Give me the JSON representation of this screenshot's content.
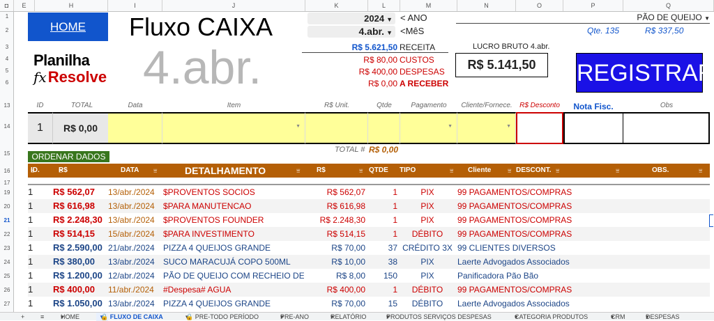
{
  "colhdr": [
    "E",
    "H",
    "I",
    "J",
    "K",
    "L",
    "M",
    "N",
    "O",
    "P",
    "Q"
  ],
  "rowhdr": [
    "1",
    "2",
    "3",
    "4",
    "5",
    "6",
    "13",
    "14",
    "15",
    "16",
    "17",
    "19",
    "20",
    "21",
    "22",
    "23",
    "24",
    "25",
    "26",
    "27"
  ],
  "home_label": "HOME",
  "title": "Fluxo CAIXA",
  "month_big": "4.abr.",
  "logo": {
    "line1": "Planilha",
    "fx": "fx",
    "line2": "Resolve"
  },
  "year_value": "2024",
  "year_label": "< ANO",
  "month_value": "4.abr.",
  "month_label": "<MêS",
  "product_select": "PÃO DE QUEIJO",
  "qte": "Qte. 135",
  "qte_value": "R$ 337,50",
  "receita_val": "R$ 5.621,50",
  "receita_lbl": "RECEITA",
  "custos_val": "R$ 80,00",
  "custos_lbl": "CUSTOS",
  "despesas_val": "R$ 400,00",
  "despesas_lbl": "DESPESAS",
  "receber_val": "R$ 0,00",
  "receber_lbl": "A RECEBER",
  "lucro_label": "LUCRO BRUTO 4.abr.",
  "lucro_value": "R$ 5.141,50",
  "registrar": "REGISTRAR",
  "entry_headers": {
    "id": "ID",
    "total": "TOTAL",
    "data": "Data",
    "item": "Item",
    "unit": "R$ Unit.",
    "qtde": "Qtde",
    "pag": "Pagamento",
    "cliente": "Cliente/Fornece.",
    "desc": "R$ Desconto",
    "nota": "Nota Fisc.",
    "obs": "Obs"
  },
  "entry_id": "1",
  "entry_total": "R$ 0,00",
  "ordenar": "ORDENAR DADOS",
  "total_label": "TOTAL #",
  "total_value": "R$ 0,00",
  "table_headers": {
    "id": "ID.",
    "total": "R$ TOTAL",
    "data": "DATA",
    "det": "DETALHAMENTO",
    "unit": "R$ UNIT",
    "qtde": "QTDE",
    "tipo": "TIPO PAGAM.",
    "cliente": "Cliente",
    "desc": "DESCONT.",
    "obs": "OBS."
  },
  "rows": [
    {
      "id": "1",
      "total": "R$ 562,07",
      "data": "13/abr./2024",
      "det": "$PROVENTOS SOCIOS",
      "unit": "R$ 562,07",
      "qtde": "1",
      "tipo": "PIX",
      "cliente": "99 PAGAMENTOS/COMPRAS"
    },
    {
      "id": "1",
      "total": "R$ 616,98",
      "data": "13/abr./2024",
      "det": "$PARA MANUTENCAO",
      "unit": "R$ 616,98",
      "qtde": "1",
      "tipo": "PIX",
      "cliente": "99 PAGAMENTOS/COMPRAS"
    },
    {
      "id": "1",
      "total": "R$ 2.248,30",
      "data": "13/abr./2024",
      "det": "$PROVENTOS FOUNDER",
      "unit": "R$ 2.248,30",
      "qtde": "1",
      "tipo": "PIX",
      "cliente": "99 PAGAMENTOS/COMPRAS"
    },
    {
      "id": "1",
      "total": "R$ 514,15",
      "data": "15/abr./2024",
      "det": "$PARA INVESTIMENTO",
      "unit": "R$ 514,15",
      "qtde": "1",
      "tipo": "DÉBITO",
      "cliente": "99 PAGAMENTOS/COMPRAS"
    },
    {
      "id": "1",
      "total": "R$ 2.590,00",
      "data": "21/abr./2024",
      "det": "PIZZA 4 QUEIJOS GRANDE",
      "unit": "R$ 70,00",
      "qtde": "37",
      "tipo": "CRÉDITO 3X",
      "cliente": "99 CLIENTES DIVERSOS"
    },
    {
      "id": "1",
      "total": "R$ 380,00",
      "data": "13/abr./2024",
      "det": "SUCO MARACUJÁ COPO 500ML",
      "unit": "R$ 10,00",
      "qtde": "38",
      "tipo": "PIX",
      "cliente": "Laerte Advogados Associados"
    },
    {
      "id": "1",
      "total": "R$ 1.200,00",
      "data": "12/abr./2024",
      "det": "PÃO DE QUEIJO COM RECHEIO DE CAR",
      "unit": "R$ 8,00",
      "qtde": "150",
      "tipo": "PIX",
      "cliente": "Panificadora Pão Bão"
    },
    {
      "id": "1",
      "total": "R$ 400,00",
      "data": "11/abr./2024",
      "det": "#Despesa# AGUA",
      "unit": "R$ 400,00",
      "qtde": "1",
      "tipo": "DÉBITO",
      "cliente": "99 PAGAMENTOS/COMPRAS"
    },
    {
      "id": "1",
      "total": "R$ 1.050,00",
      "data": "13/abr./2024",
      "det": "PIZZA 4 QUEIJOS GRANDE",
      "unit": "R$ 70,00",
      "qtde": "15",
      "tipo": "DÉBITO",
      "cliente": "Laerte Advogados Associados"
    }
  ],
  "tabs": [
    "+",
    "≡",
    "HOME",
    "🔒 FLUXO DE CAIXA",
    "🔒 PRE-TODO PERÍODO",
    "PRE-ANO",
    "RELATÓRIO",
    "PRODUTOS SERVIÇOS DESPESAS",
    "CATEGORIA PRODUTOS",
    "CRM",
    "DESPESAS"
  ],
  "colors": {
    "home": "#1155cc",
    "registrar": "#1a11e6",
    "header": "#b45f06",
    "green": "#38761d",
    "red": "#cc0000",
    "blue": "#1155cc"
  }
}
